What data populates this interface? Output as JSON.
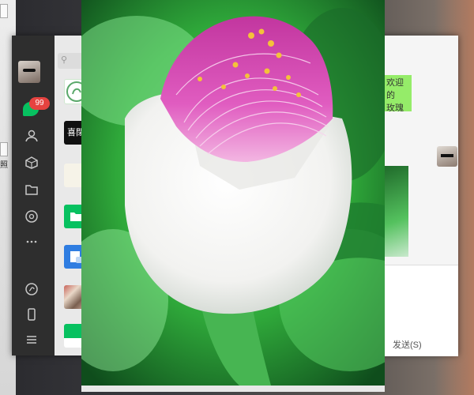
{
  "sidebar": {
    "badge_count": "99",
    "icons": [
      "chat-icon",
      "contacts-icon",
      "favorites-icon",
      "files-icon",
      "moments-icon",
      "more-icon",
      "mini-program-icon",
      "phone-icon",
      "menu-icon"
    ]
  },
  "chat": {
    "received_snippet": "欢迎的\n玫瑰",
    "send_label": "发送(S)"
  },
  "desktop": {
    "label": "照"
  },
  "thumb": {
    "label": "喜閉"
  },
  "colors": {
    "wechat_green": "#07c160",
    "bubble_green": "#95ec69",
    "badge_red": "#e64340",
    "flower_pink": "#e05cc0",
    "leaf_green": "#2fa83a"
  }
}
